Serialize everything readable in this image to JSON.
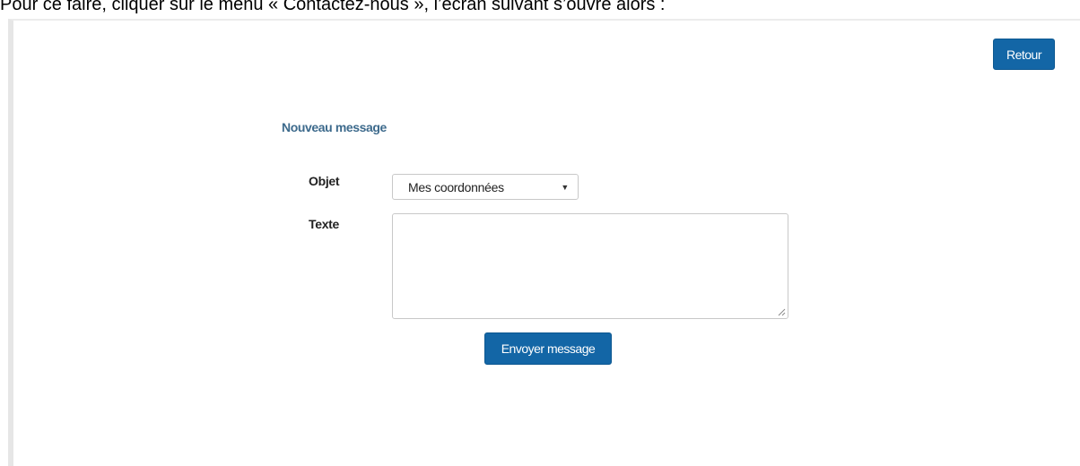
{
  "intro_text": "Pour ce faire, cliquer sur le menu « Contactez-nous », l’écran suivant s’ouvre alors :",
  "header": {
    "back_label": "Retour"
  },
  "form": {
    "title": "Nouveau message",
    "subject": {
      "label": "Objet",
      "selected": "Mes coordonnées"
    },
    "text": {
      "label": "Texte",
      "value": ""
    },
    "send_label": "Envoyer message"
  },
  "colors": {
    "primary_button": "#1366a6",
    "title_color": "#3d6a8c"
  },
  "icons": {
    "dropdown": "caret-down-icon",
    "resize": "resize-grip-icon"
  }
}
